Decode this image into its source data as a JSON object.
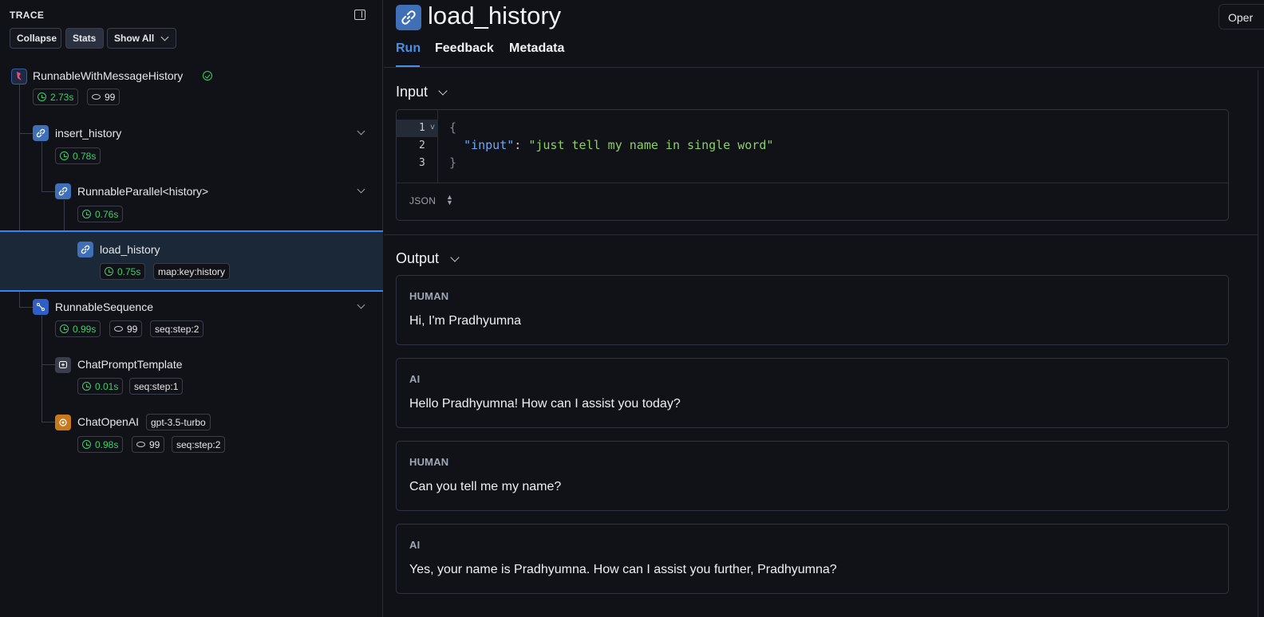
{
  "trace": {
    "title": "TRACE",
    "buttons": {
      "collapse": "Collapse",
      "stats": "Stats",
      "show_all": "Show All"
    },
    "nodes": [
      {
        "name": "RunnableWithMessageHistory",
        "time": "2.73s",
        "tokens": "99"
      },
      {
        "name": "insert_history",
        "time": "0.78s"
      },
      {
        "name": "RunnableParallel<history>",
        "time": "0.76s"
      },
      {
        "name": "load_history",
        "time": "0.75s",
        "tag": "map:key:history"
      },
      {
        "name": "RunnableSequence",
        "time": "0.99s",
        "tokens": "99",
        "tag": "seq:step:2"
      },
      {
        "name": "ChatPromptTemplate",
        "time": "0.01s",
        "tag": "seq:step:1"
      },
      {
        "name": "ChatOpenAI",
        "model": "gpt-3.5-turbo",
        "time": "0.98s",
        "tokens": "99",
        "tag": "seq:step:2"
      }
    ]
  },
  "header": {
    "title": "load_history",
    "open_button": "Oper"
  },
  "tabs": [
    "Run",
    "Feedback",
    "Metadata"
  ],
  "input": {
    "title": "Input",
    "lines": [
      "1",
      "2",
      "3"
    ],
    "open_brace": "{",
    "key": "\"input\"",
    "colon": ": ",
    "value": "\"just tell my name in single word\"",
    "close_brace": "}",
    "format": "JSON"
  },
  "output": {
    "title": "Output",
    "messages": [
      {
        "role": "HUMAN",
        "text": "Hi, I'm Pradhyumna"
      },
      {
        "role": "AI",
        "text": "Hello Pradhyumna! How can I assist you today?"
      },
      {
        "role": "HUMAN",
        "text": "Can you tell me my name?"
      },
      {
        "role": "AI",
        "text": "Yes, your name is Pradhyumna. How can I assist you further, Pradhyumna?"
      }
    ]
  },
  "colors": {
    "accent": "#4a90e2",
    "success": "#3ecf6e",
    "background": "#111217",
    "selected": "#1b2838"
  }
}
